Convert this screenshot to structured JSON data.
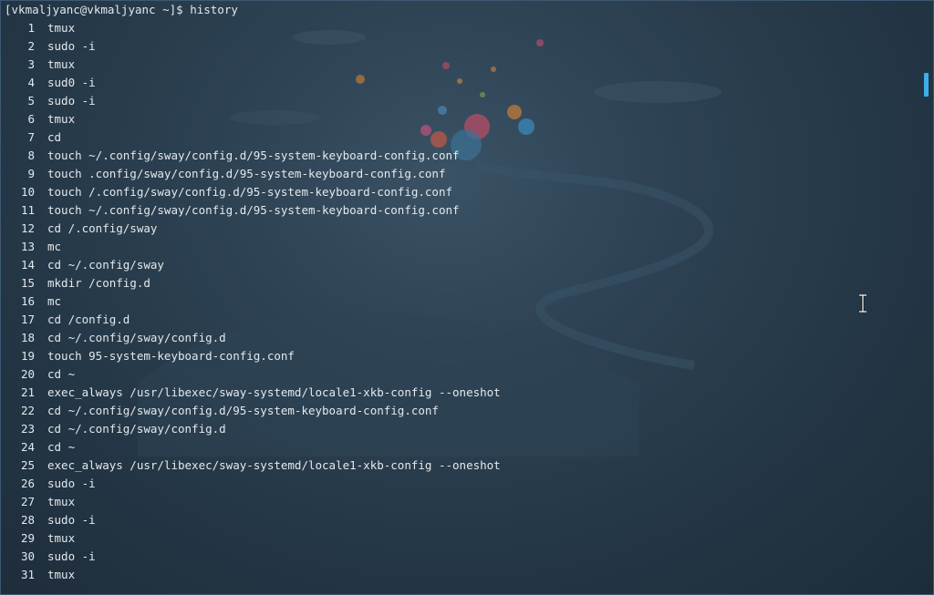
{
  "terminal": {
    "prompt": "[vkmaljyanc@vkmaljyanc ~]$ history",
    "history": [
      {
        "num": "1",
        "cmd": "tmux"
      },
      {
        "num": "2",
        "cmd": "sudo -i"
      },
      {
        "num": "3",
        "cmd": "tmux"
      },
      {
        "num": "4",
        "cmd": "sud0 -i"
      },
      {
        "num": "5",
        "cmd": "sudo -i"
      },
      {
        "num": "6",
        "cmd": "tmux"
      },
      {
        "num": "7",
        "cmd": "cd"
      },
      {
        "num": "8",
        "cmd": "touch ~/.config/sway/config.d/95-system-keyboard-config.conf"
      },
      {
        "num": "9",
        "cmd": "touch .config/sway/config.d/95-system-keyboard-config.conf"
      },
      {
        "num": "10",
        "cmd": "touch /.config/sway/config.d/95-system-keyboard-config.conf"
      },
      {
        "num": "11",
        "cmd": "touch ~/.config/sway/config.d/95-system-keyboard-config.conf"
      },
      {
        "num": "12",
        "cmd": "cd /.config/sway"
      },
      {
        "num": "13",
        "cmd": "mc"
      },
      {
        "num": "14",
        "cmd": "cd ~/.config/sway"
      },
      {
        "num": "15",
        "cmd": "mkdir /config.d"
      },
      {
        "num": "16",
        "cmd": "mc"
      },
      {
        "num": "17",
        "cmd": "cd /config.d"
      },
      {
        "num": "18",
        "cmd": "cd ~/.config/sway/config.d"
      },
      {
        "num": "19",
        "cmd": "touch 95-system-keyboard-config.conf"
      },
      {
        "num": "20",
        "cmd": "cd ~"
      },
      {
        "num": "21",
        "cmd": "exec_always /usr/libexec/sway-systemd/locale1-xkb-config --oneshot"
      },
      {
        "num": "22",
        "cmd": "cd ~/.config/sway/config.d/95-system-keyboard-config.conf"
      },
      {
        "num": "23",
        "cmd": "cd ~/.config/sway/config.d"
      },
      {
        "num": "24",
        "cmd": "cd ~"
      },
      {
        "num": "25",
        "cmd": "exec_always /usr/libexec/sway-systemd/locale1-xkb-config --oneshot"
      },
      {
        "num": "26",
        "cmd": "sudo -i"
      },
      {
        "num": "27",
        "cmd": "tmux"
      },
      {
        "num": "28",
        "cmd": "sudo -i"
      },
      {
        "num": "29",
        "cmd": "tmux"
      },
      {
        "num": "30",
        "cmd": "sudo -i"
      },
      {
        "num": "31",
        "cmd": "tmux"
      }
    ]
  },
  "colors": {
    "background": "#233544",
    "text": "#e4e8ec",
    "scrollbar_thumb": "#3daee9"
  },
  "icons": {
    "cursor": "ibeam-cursor-icon"
  }
}
